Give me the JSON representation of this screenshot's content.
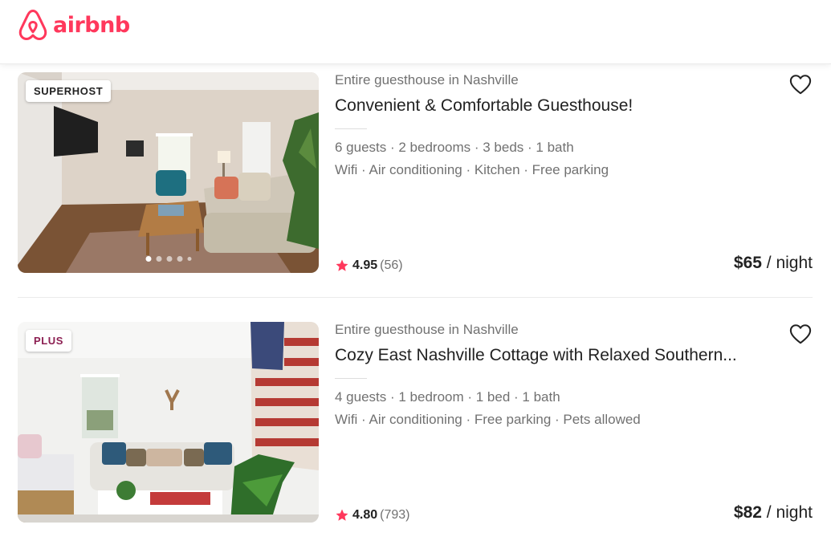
{
  "header": {
    "logo_text": "airbnb",
    "brand_color": "#FF385C"
  },
  "listings": [
    {
      "badge": "SUPERHOST",
      "subtitle": "Entire guesthouse in Nashville",
      "title": "Convenient & Comfortable Guesthouse!",
      "details": "6 guests · 2 bedrooms · 3 beds · 1 bath",
      "amenities": "Wifi · Air conditioning · Kitchen · Free parking",
      "rating": "4.95",
      "reviews": "(56)",
      "price": "$65",
      "price_unit": "/ night",
      "photo_dots": 5,
      "active_dot": 1
    },
    {
      "badge": "PLUS",
      "badge_color": "#8C1F52",
      "subtitle": "Entire guesthouse in Nashville",
      "title": "Cozy East Nashville Cottage with Relaxed Southern...",
      "details": "4 guests · 1 bedroom · 1 bed · 1 bath",
      "amenities": "Wifi · Air conditioning · Free parking · Pets allowed",
      "rating": "4.80",
      "reviews": "(793)",
      "price": "$82",
      "price_unit": "/ night",
      "photo_dots": 5,
      "active_dot": 1
    }
  ],
  "icons": {
    "favorite": "heart-outline-icon",
    "rating": "star-icon"
  },
  "colors": {
    "star": "#FF385C",
    "secondary_text": "#717171"
  }
}
